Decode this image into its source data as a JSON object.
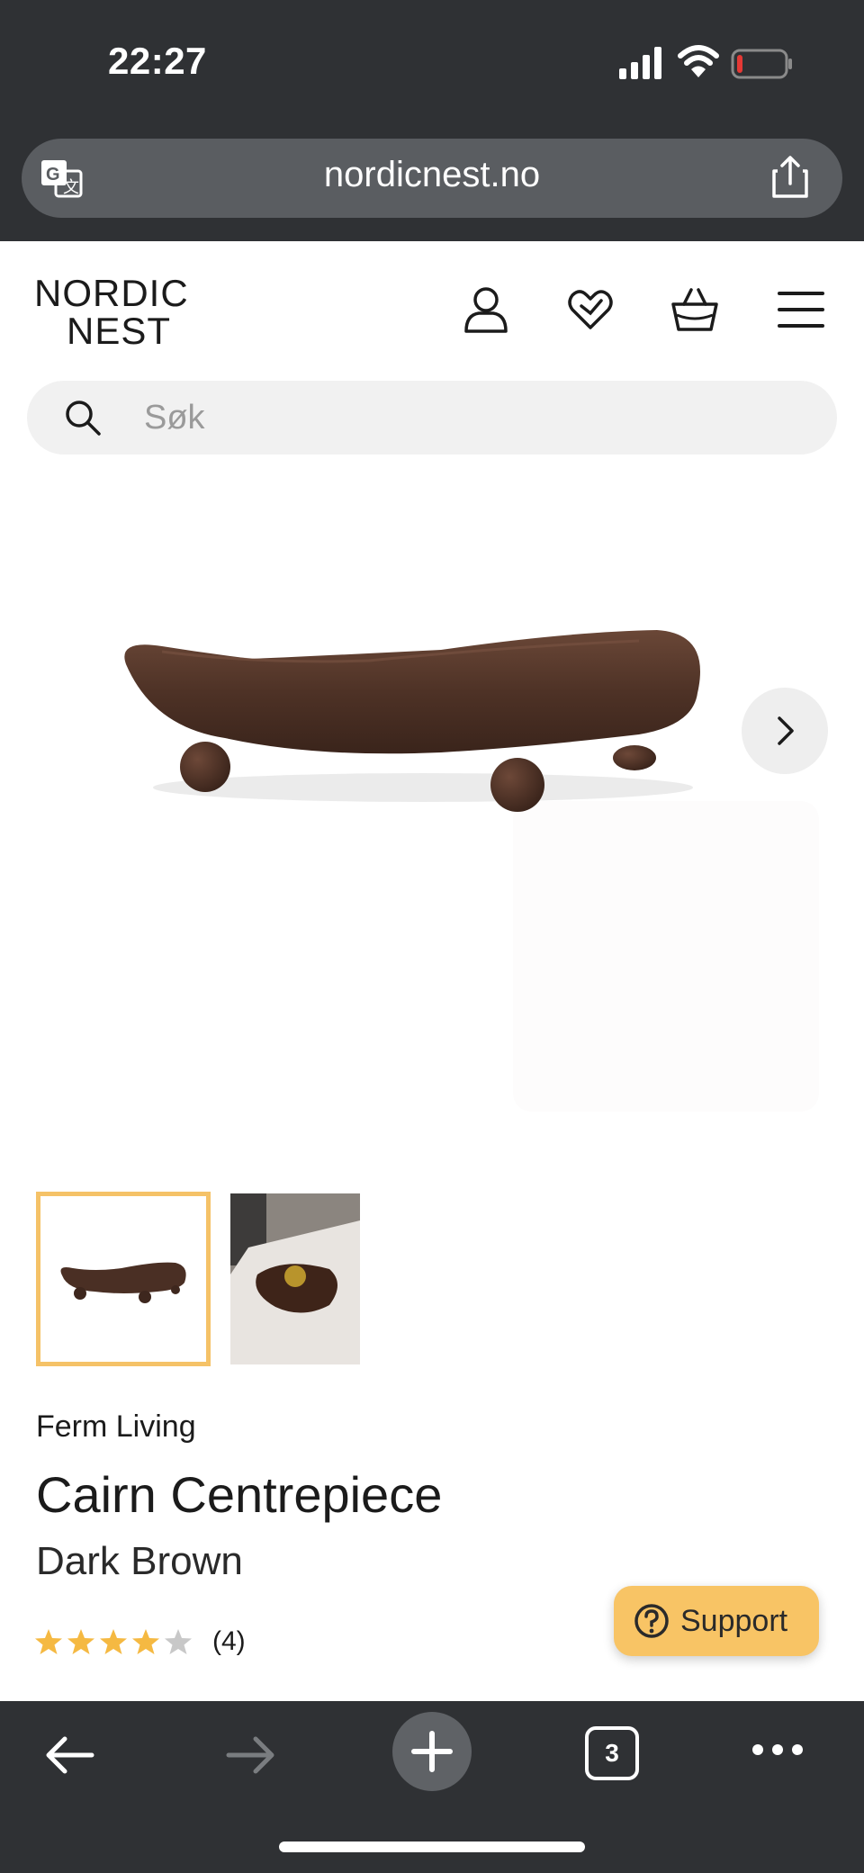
{
  "status_bar": {
    "time": "22:27"
  },
  "browser": {
    "url": "nordicnest.no",
    "tab_count": "3"
  },
  "header": {
    "logo_line1": "NORDIC",
    "logo_line2": "NEST"
  },
  "search": {
    "placeholder": "Søk"
  },
  "product": {
    "brand": "Ferm Living",
    "title": "Cairn Centrepiece",
    "variant": "Dark Brown",
    "rating": 4,
    "rating_max": 5,
    "review_count": "(4)"
  },
  "support": {
    "label": "Support"
  },
  "colors": {
    "accent": "#f8c465",
    "thumb_selected_border": "#f5c267",
    "star_filled": "#f5b942",
    "star_empty": "#c8c8c8",
    "browser_chrome": "#2f3134"
  }
}
